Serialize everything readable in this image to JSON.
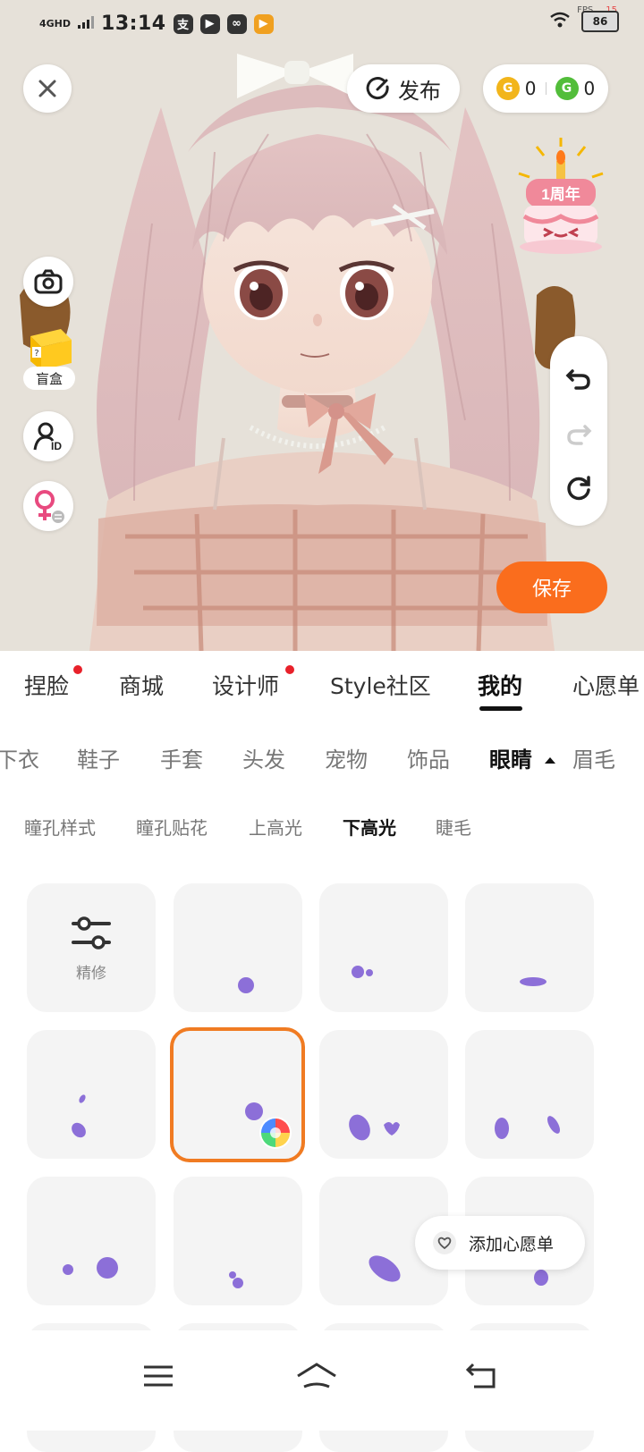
{
  "status_bar": {
    "network": "4GHD",
    "time": "13:14",
    "fps_label": "FPS",
    "fps_value": "15",
    "battery": "86"
  },
  "top": {
    "close_icon": "close-icon",
    "publish_label": "发布",
    "coin_gold": "0",
    "coin_green": "0",
    "anniversary_text": "1周年"
  },
  "left_tools": {
    "blind_box_label": "盲盒"
  },
  "save_label": "保存",
  "main_tabs": [
    {
      "label": "捏脸",
      "dot": true
    },
    {
      "label": "商城",
      "dot": false
    },
    {
      "label": "设计师",
      "dot": true
    },
    {
      "label": "Style社区",
      "dot": false
    },
    {
      "label": "我的",
      "dot": false,
      "active": true
    },
    {
      "label": "心愿单",
      "dot": false
    }
  ],
  "category_tabs": [
    "下衣",
    "鞋子",
    "手套",
    "头发",
    "宠物",
    "饰品",
    "眼睛",
    "眉毛"
  ],
  "category_active": "眼睛",
  "sub_tabs": [
    "瞳孔样式",
    "瞳孔贴花",
    "上高光",
    "下高光",
    "睫毛"
  ],
  "sub_active": "下高光",
  "grid": {
    "refine_label": "精修",
    "selected_index": 5
  },
  "wishlist_label": "添加心愿单",
  "colors": {
    "accent": "#fa6d1d",
    "highlight": "#8c6fd8",
    "selected_border": "#f07b22",
    "notify_dot": "#e8212a"
  }
}
